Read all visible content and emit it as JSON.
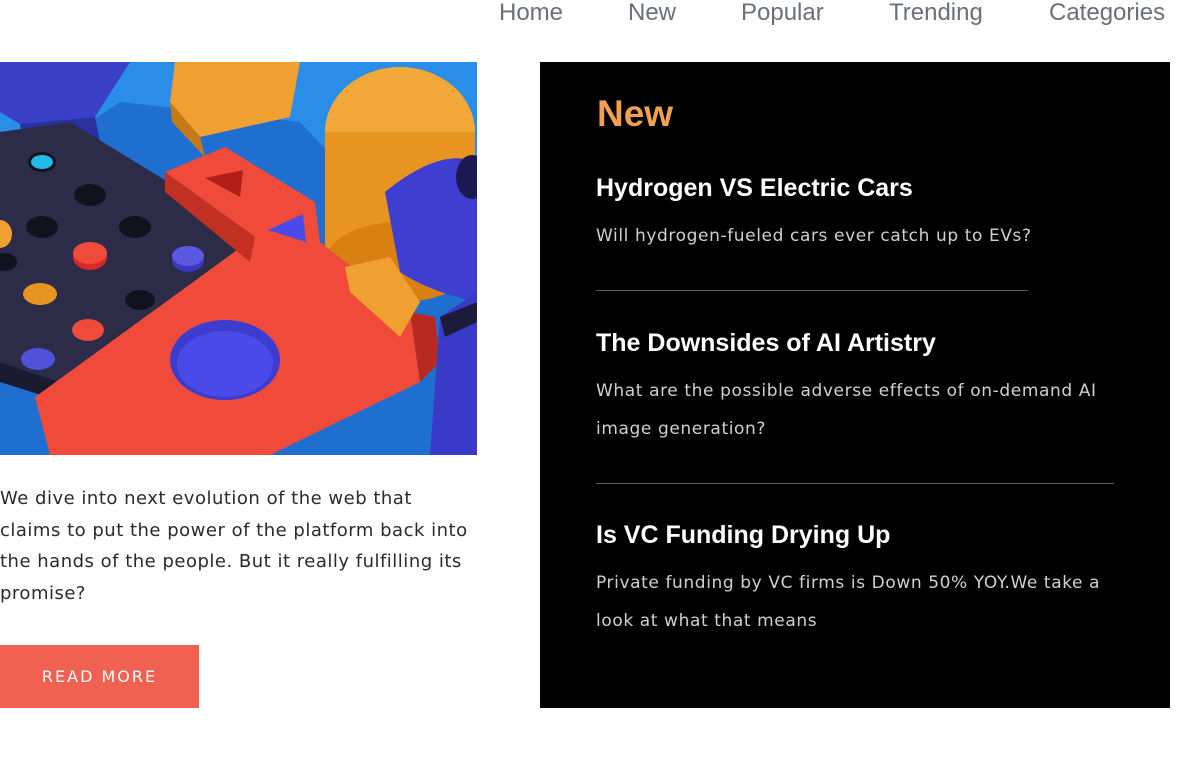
{
  "nav": {
    "items": [
      "Home",
      "New",
      "Popular",
      "Trending",
      "Categories"
    ]
  },
  "feature": {
    "excerpt": "We dive into next evolution of the web that claims to put the power of the platform back into the hands of the people. But it really fulfilling its promise?",
    "button_label": "READ MORE",
    "button_color": "#f06151"
  },
  "sidebar": {
    "title": "New",
    "title_color": "#f0a050",
    "posts": [
      {
        "title": "Hydrogen VS Electric Cars",
        "summary": "Will hydrogen-fueled cars ever catch up to EVs?"
      },
      {
        "title": "The Downsides of AI Artistry",
        "summary": "What are the possible adverse effects of on-demand AI image generation?"
      },
      {
        "title": "Is VC Funding Drying Up",
        "summary": "Private funding by VC firms is Down 50% YOY.We take a look at what that means"
      }
    ]
  }
}
